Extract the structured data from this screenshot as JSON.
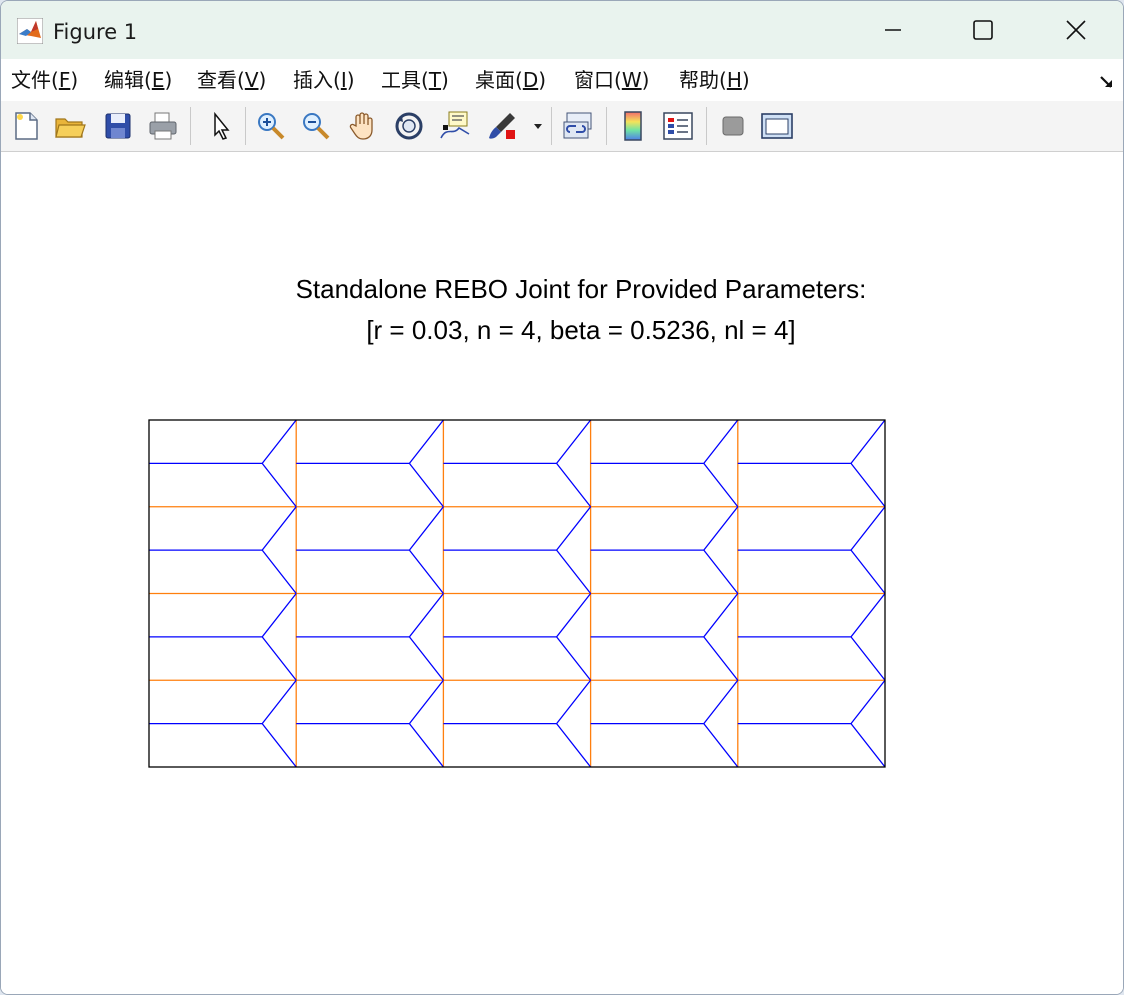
{
  "window": {
    "title": "Figure 1"
  },
  "menu": {
    "items": [
      {
        "prefix": "文件(",
        "key": "F",
        "suffix": ")"
      },
      {
        "prefix": "编辑(",
        "key": "E",
        "suffix": ")"
      },
      {
        "prefix": "查看(",
        "key": "V",
        "suffix": ")"
      },
      {
        "prefix": "插入(",
        "key": "I",
        "suffix": ")"
      },
      {
        "prefix": "工具(",
        "key": "T",
        "suffix": ")"
      },
      {
        "prefix": "桌面(",
        "key": "D",
        "suffix": ")"
      },
      {
        "prefix": "窗口(",
        "key": "W",
        "suffix": ")"
      },
      {
        "prefix": "帮助(",
        "key": "H",
        "suffix": ")"
      }
    ]
  },
  "toolbar": {
    "icons": [
      "new-figure-icon",
      "open-file-icon",
      "save-icon",
      "print-icon",
      "edit-plot-arrow-icon",
      "zoom-in-icon",
      "zoom-out-icon",
      "pan-hand-icon",
      "rotate-3d-icon",
      "data-cursor-icon",
      "brush-icon",
      "link-plot-icon",
      "colorbar-icon",
      "legend-icon",
      "hide-plot-tools-icon",
      "show-plot-tools-icon"
    ]
  },
  "figure": {
    "title_line1": "Standalone REBO Joint for Provided Parameters:",
    "title_line2": "[r = 0.03, n = 4, beta = 0.5236, nl = 4]"
  },
  "colors": {
    "blue_crease": "#0000ff",
    "orange_crease": "#ff7f0e",
    "frame": "#000000"
  },
  "chart_data": {
    "type": "line",
    "panels": 5,
    "rows": 8,
    "series": [],
    "grid": false
  }
}
